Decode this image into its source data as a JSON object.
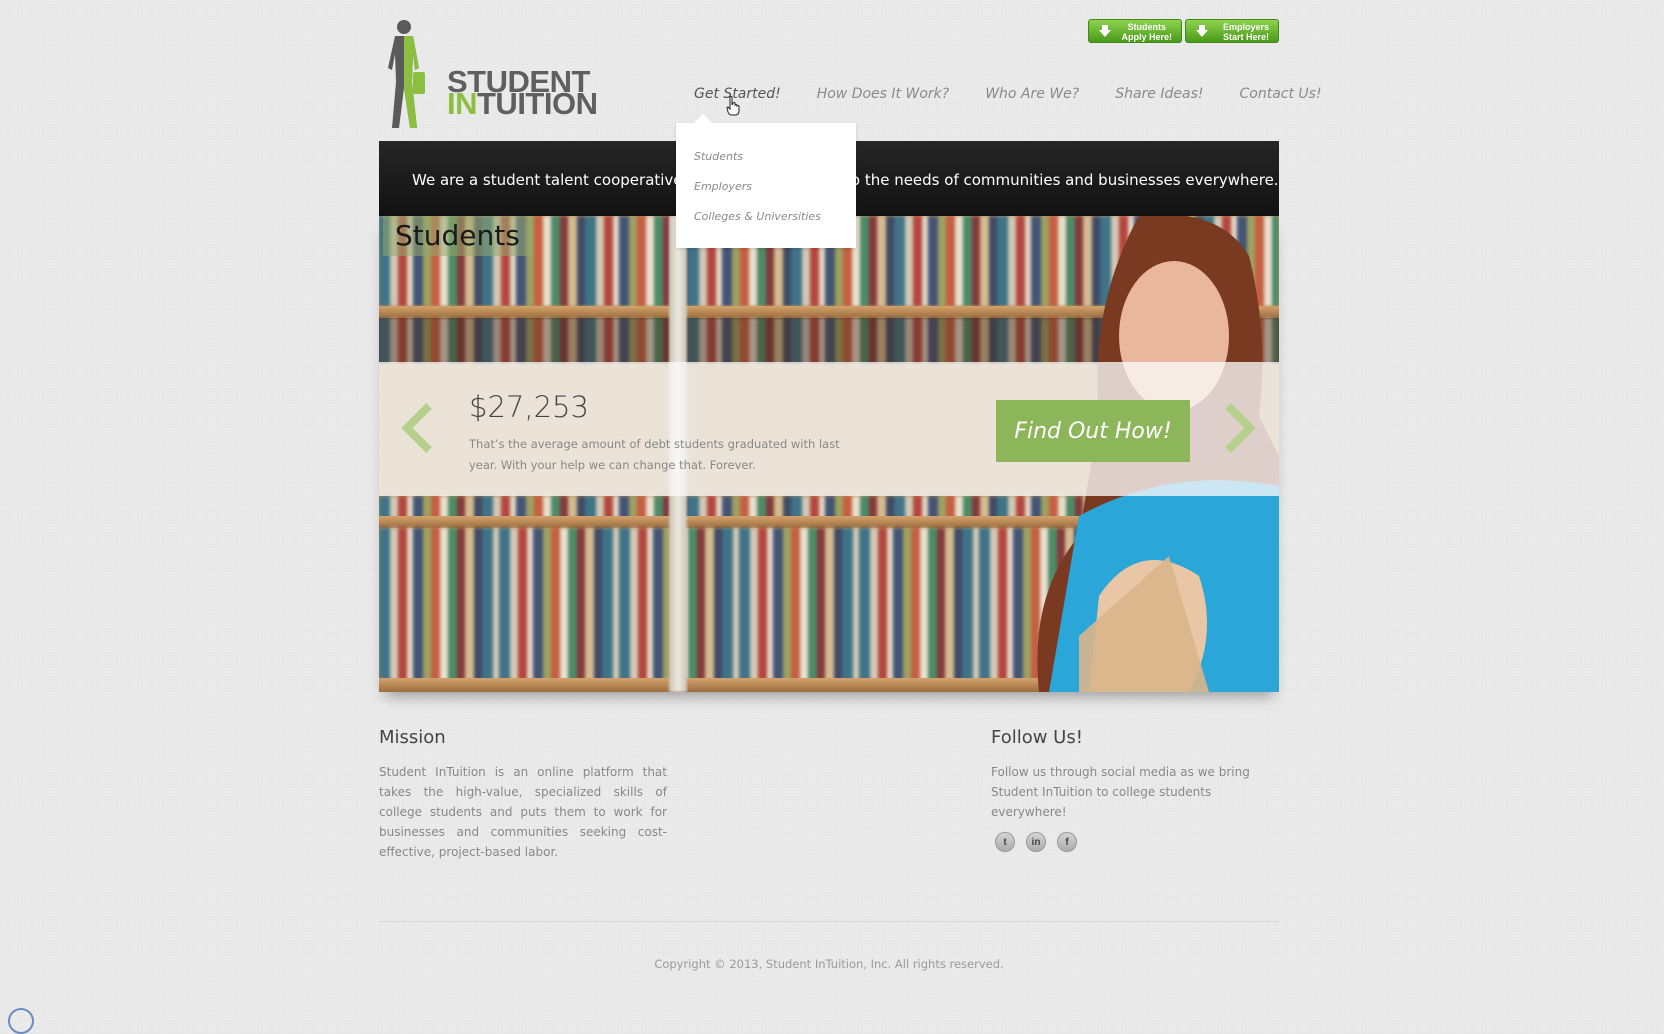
{
  "logo": {
    "line1": "STUDENT",
    "line2_accent": "IN",
    "line2_rest": "TUITION",
    "accent_color": "#8cbe3f"
  },
  "top_buttons": {
    "students": {
      "line1": "Students",
      "line2": "Apply Here!"
    },
    "employers": {
      "line1": "Employers",
      "line2": "Start Here!"
    }
  },
  "nav": {
    "items": [
      {
        "label": "Get Started!"
      },
      {
        "label": "How Does It Work?"
      },
      {
        "label": "Who Are We?"
      },
      {
        "label": "Share Ideas!"
      },
      {
        "label": "Contact Us!"
      }
    ],
    "dropdown": [
      "Students",
      "Employers",
      "Colleges & Universities"
    ]
  },
  "banner": {
    "text": "We are a student talent cooperative connecting students to the needs of communities and businesses everywhere."
  },
  "slider": {
    "tag": "Students",
    "stat": "$27,253",
    "description": "That’s the average amount of debt students graduated with last year. With your help we can change that. Forever.",
    "cta": "Find Out How!"
  },
  "mission": {
    "title": "Mission",
    "text": "Student InTuition is an online platform that takes the high-value, specialized skills of college students and puts them to work for businesses and communities seeking cost-effective, project-based labor."
  },
  "follow": {
    "title": "Follow Us!",
    "text": "Follow us through social media as we bring Student InTuition to college students everywhere!",
    "icons": [
      "twitter-icon",
      "linkedin-icon",
      "facebook-icon"
    ]
  },
  "footer": {
    "copyright": "Copyright © 2013, Student InTuition, Inc. All rights reserved."
  }
}
